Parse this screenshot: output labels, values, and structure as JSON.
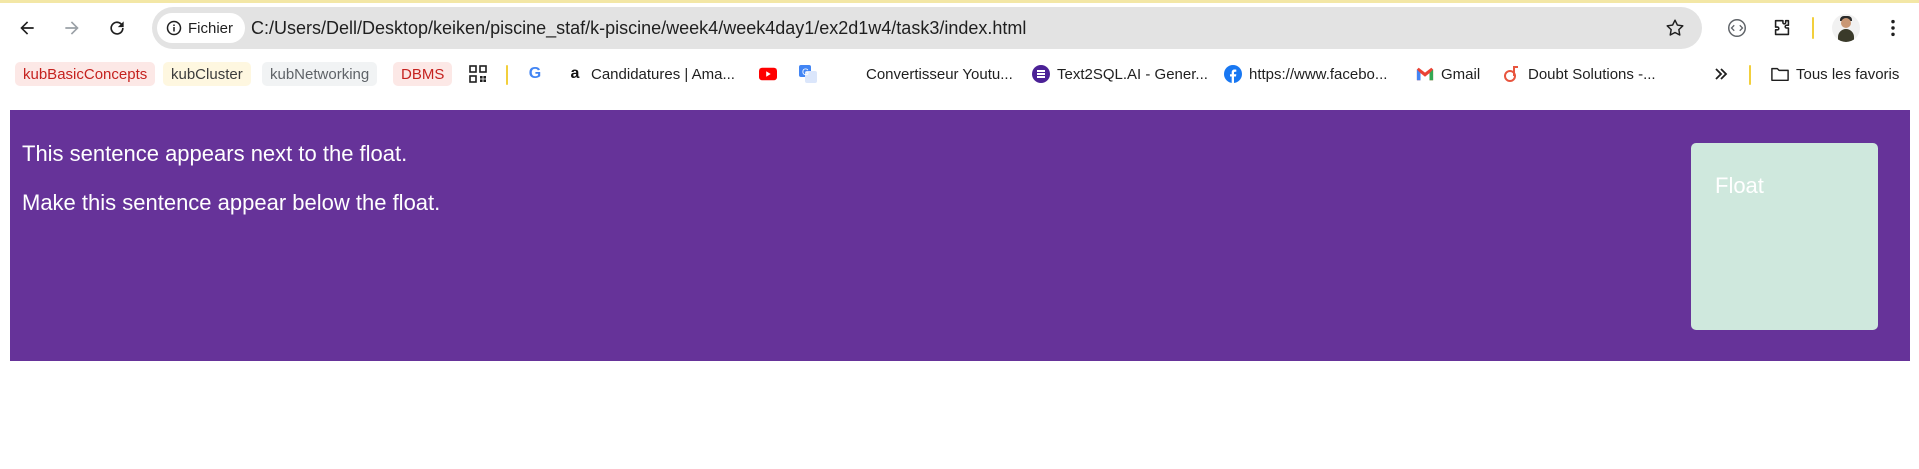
{
  "toolbar": {
    "site_info_label": "Fichier",
    "url": "C:/Users/Dell/Desktop/keiken/piscine_staf/k-piscine/week4/week4day1/ex2d1w4/task3/index.html"
  },
  "bookmarks": {
    "items": [
      {
        "label": "kubBasicConcepts",
        "color": "#c5221f",
        "bg": "#fce8e6"
      },
      {
        "label": "kubCluster",
        "color": "#3c3c3c",
        "bg": "#fef7e0"
      },
      {
        "label": "kubNetworking",
        "color": "#5f6368",
        "bg": "#f1f3f4"
      },
      {
        "label": "DBMS",
        "color": "#c5221f",
        "bg": "#fce8e6"
      }
    ],
    "links": [
      {
        "label": "Candidatures | Ama...",
        "icon": "amazon-icon"
      },
      {
        "label": "Convertisseur Youtu...",
        "icon": "blank"
      },
      {
        "label": "Text2SQL.AI - Gener...",
        "icon": "text2sql-icon"
      },
      {
        "label": "https://www.facebo...",
        "icon": "facebook-icon"
      },
      {
        "label": "Gmail",
        "icon": "gmail-icon"
      },
      {
        "label": "Doubt Solutions -...",
        "icon": "doubt-icon"
      }
    ],
    "all_bookmarks_label": "Tous les favoris"
  },
  "page": {
    "background": "#663399",
    "float_color": "#cfe8dd",
    "float_label": "Float",
    "sentence_1": "This sentence appears next to the float.",
    "sentence_2": "Make this sentence appear below the float."
  }
}
